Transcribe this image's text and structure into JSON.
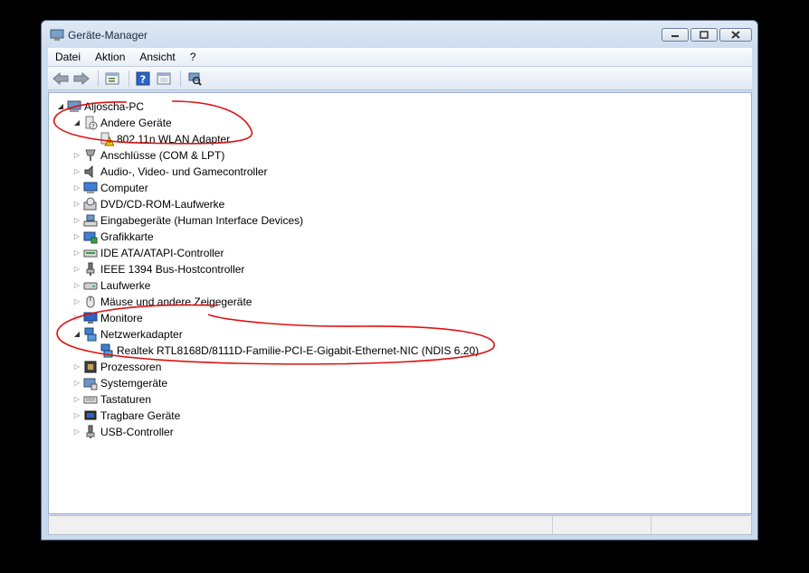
{
  "window": {
    "title": "Geräte-Manager"
  },
  "menu": {
    "items": [
      "Datei",
      "Aktion",
      "Ansicht",
      "?"
    ]
  },
  "toolbar": {
    "buttons": [
      "back-arrow-icon",
      "forward-arrow-icon",
      "properties-icon",
      "help-icon",
      "view-icon",
      "scan-hardware-icon"
    ]
  },
  "tree": {
    "root": "Aljoscha-PC",
    "nodes": [
      {
        "label": "Andere Geräte",
        "expanded": true,
        "icon": "unknown-device-icon"
      },
      {
        "label": "802.11n WLAN Adapter",
        "child": true,
        "icon": "warning-device-icon"
      },
      {
        "label": "Anschlüsse (COM & LPT)",
        "icon": "port-icon"
      },
      {
        "label": "Audio-, Video- und Gamecontroller",
        "icon": "speaker-icon"
      },
      {
        "label": "Computer",
        "icon": "computer-icon"
      },
      {
        "label": "DVD/CD-ROM-Laufwerke",
        "icon": "disc-icon"
      },
      {
        "label": "Eingabegeräte (Human Interface Devices)",
        "icon": "hid-icon"
      },
      {
        "label": "Grafikkarte",
        "icon": "display-adapter-icon"
      },
      {
        "label": "IDE ATA/ATAPI-Controller",
        "icon": "ide-icon"
      },
      {
        "label": "IEEE 1394 Bus-Hostcontroller",
        "icon": "firewire-icon"
      },
      {
        "label": "Laufwerke",
        "icon": "drive-icon"
      },
      {
        "label": "Mäuse und andere Zeigegeräte",
        "icon": "mouse-icon"
      },
      {
        "label": "Monitore",
        "icon": "monitor-icon"
      },
      {
        "label": "Netzwerkadapter",
        "expanded": true,
        "icon": "network-icon"
      },
      {
        "label": "Realtek RTL8168D/8111D-Familie-PCI-E-Gigabit-Ethernet-NIC (NDIS 6.20)",
        "child": true,
        "icon": "network-icon"
      },
      {
        "label": "Prozessoren",
        "icon": "processor-icon"
      },
      {
        "label": "Systemgeräte",
        "icon": "system-icon"
      },
      {
        "label": "Tastaturen",
        "icon": "keyboard-icon"
      },
      {
        "label": "Tragbare Geräte",
        "icon": "portable-icon"
      },
      {
        "label": "USB-Controller",
        "icon": "usb-icon"
      }
    ]
  },
  "colors": {
    "annotation": "#e01010",
    "tree_bg": "#ffffff",
    "frame": "#c9d9ee"
  }
}
